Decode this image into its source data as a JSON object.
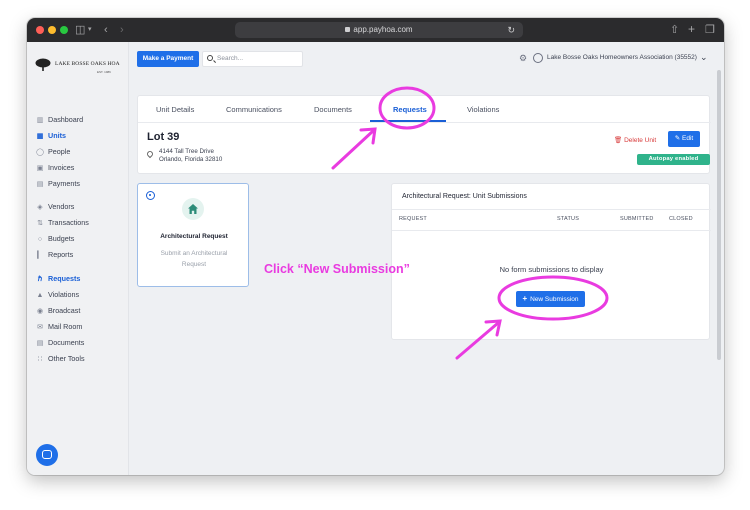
{
  "browser": {
    "url": "app.payhoa.com",
    "traffic_colors": [
      "#ff5f57",
      "#febc2e",
      "#28c840"
    ]
  },
  "brand": {
    "logo_text": "LAKE BOSSE OAKS HOA",
    "logo_subtext": "EST. 1986"
  },
  "header": {
    "make_payment_label": "Make a Payment",
    "search_placeholder": "Search...",
    "organization": "Lake Bosse Oaks Homeowners Association (35552)"
  },
  "sidebar": {
    "items": [
      {
        "label": "Dashboard",
        "icon": "dashboard-icon"
      },
      {
        "label": "Units",
        "icon": "units-icon",
        "active": true
      },
      {
        "label": "People",
        "icon": "people-icon"
      },
      {
        "label": "Invoices",
        "icon": "invoices-icon"
      },
      {
        "label": "Payments",
        "icon": "payments-icon"
      },
      {
        "label": "Vendors",
        "icon": "vendors-icon"
      },
      {
        "label": "Transactions",
        "icon": "transactions-icon"
      },
      {
        "label": "Budgets",
        "icon": "budgets-icon"
      },
      {
        "label": "Reports",
        "icon": "reports-icon"
      },
      {
        "label": "Requests",
        "icon": "requests-icon",
        "active": true
      },
      {
        "label": "Violations",
        "icon": "violations-icon"
      },
      {
        "label": "Broadcast",
        "icon": "broadcast-icon"
      },
      {
        "label": "Mail Room",
        "icon": "mail-room-icon"
      },
      {
        "label": "Documents",
        "icon": "documents-icon"
      },
      {
        "label": "Other Tools",
        "icon": "other-tools-icon"
      }
    ]
  },
  "tabs": [
    {
      "label": "Unit Details"
    },
    {
      "label": "Communications"
    },
    {
      "label": "Documents"
    },
    {
      "label": "Requests",
      "active": true
    },
    {
      "label": "Violations"
    }
  ],
  "unit": {
    "title": "Lot 39",
    "address_line1": "4144 Tall Tree Drive",
    "address_line2": "Orlando, Florida 32810",
    "delete_label": "Delete Unit",
    "edit_label": "Edit",
    "autopay_label": "Autopay enabled"
  },
  "form_card": {
    "title": "Architectural Request",
    "description": "Submit an Architectural Request"
  },
  "submissions": {
    "title": "Architectural Request: Unit Submissions",
    "columns": [
      "REQUEST",
      "STATUS",
      "SUBMITTED",
      "CLOSED"
    ],
    "empty_text": "No form submissions to display",
    "new_submission_label": "New Submission"
  },
  "annotation": {
    "callout_text": "Click “New Submission”",
    "color": "#e93be0"
  },
  "colors": {
    "primary": "#1f6fe8",
    "danger": "#d83b3b",
    "success": "#2fb38b"
  }
}
